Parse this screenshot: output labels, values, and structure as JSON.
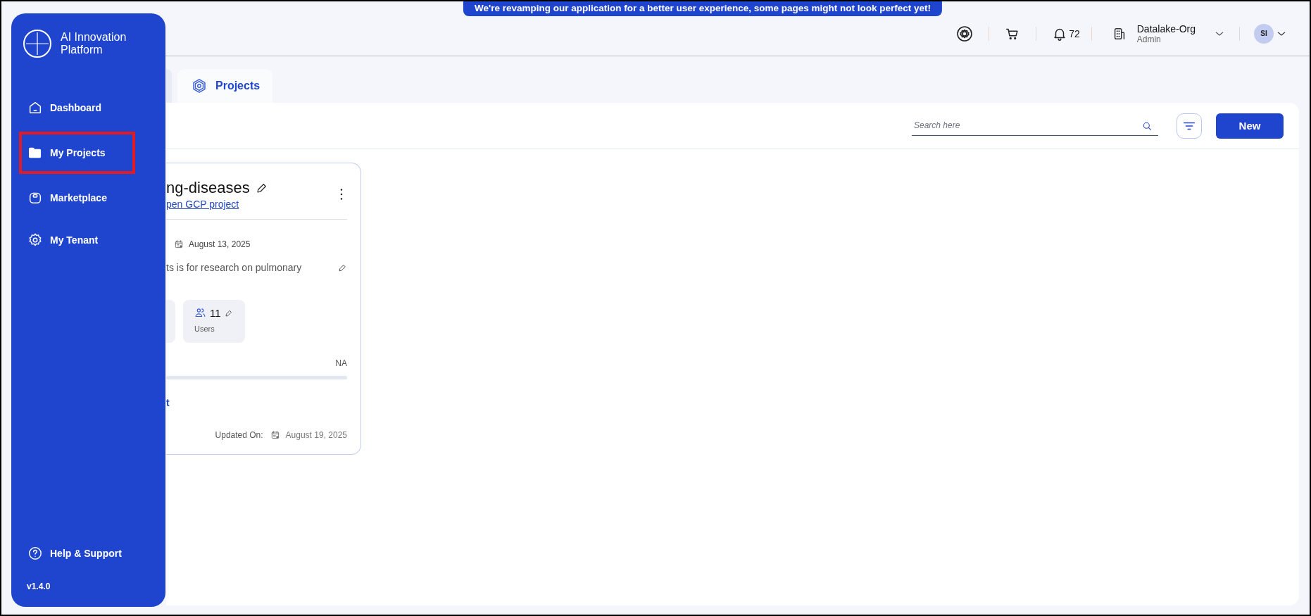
{
  "banner": "We're revamping our application for a better user experience, some pages might not look perfect yet!",
  "header": {
    "notifications": "72",
    "org": {
      "name": "Datalake-Org",
      "role": "Admin"
    },
    "avatar": "SI"
  },
  "sidebar": {
    "title": "AI Innovation Platform",
    "items": [
      {
        "kind": "dashboard",
        "label": "Dashboard",
        "highlighted": false
      },
      {
        "kind": "projects",
        "label": "My Projects",
        "highlighted": true
      },
      {
        "kind": "marketplace",
        "label": "Marketplace",
        "highlighted": false
      },
      {
        "kind": "tenant",
        "label": "My Tenant",
        "highlighted": false
      }
    ],
    "help": "Help & Support",
    "version": "v1.4.0"
  },
  "tabs": [
    {
      "label": "Projects",
      "selected": true
    }
  ],
  "toolbar": {
    "search": {
      "placeholder": "Search here"
    },
    "new_button": "New"
  },
  "project_card": {
    "title": "ng-diseases",
    "link": "pen GCP project",
    "created": "August 13, 2025",
    "description": "ts is for research on pulmonary",
    "users": {
      "count": "11",
      "label": "Users"
    },
    "progress": {
      "reading": "NA"
    },
    "action_link": "t",
    "updated_label": "Updated On:",
    "updated": "August 19, 2025"
  }
}
